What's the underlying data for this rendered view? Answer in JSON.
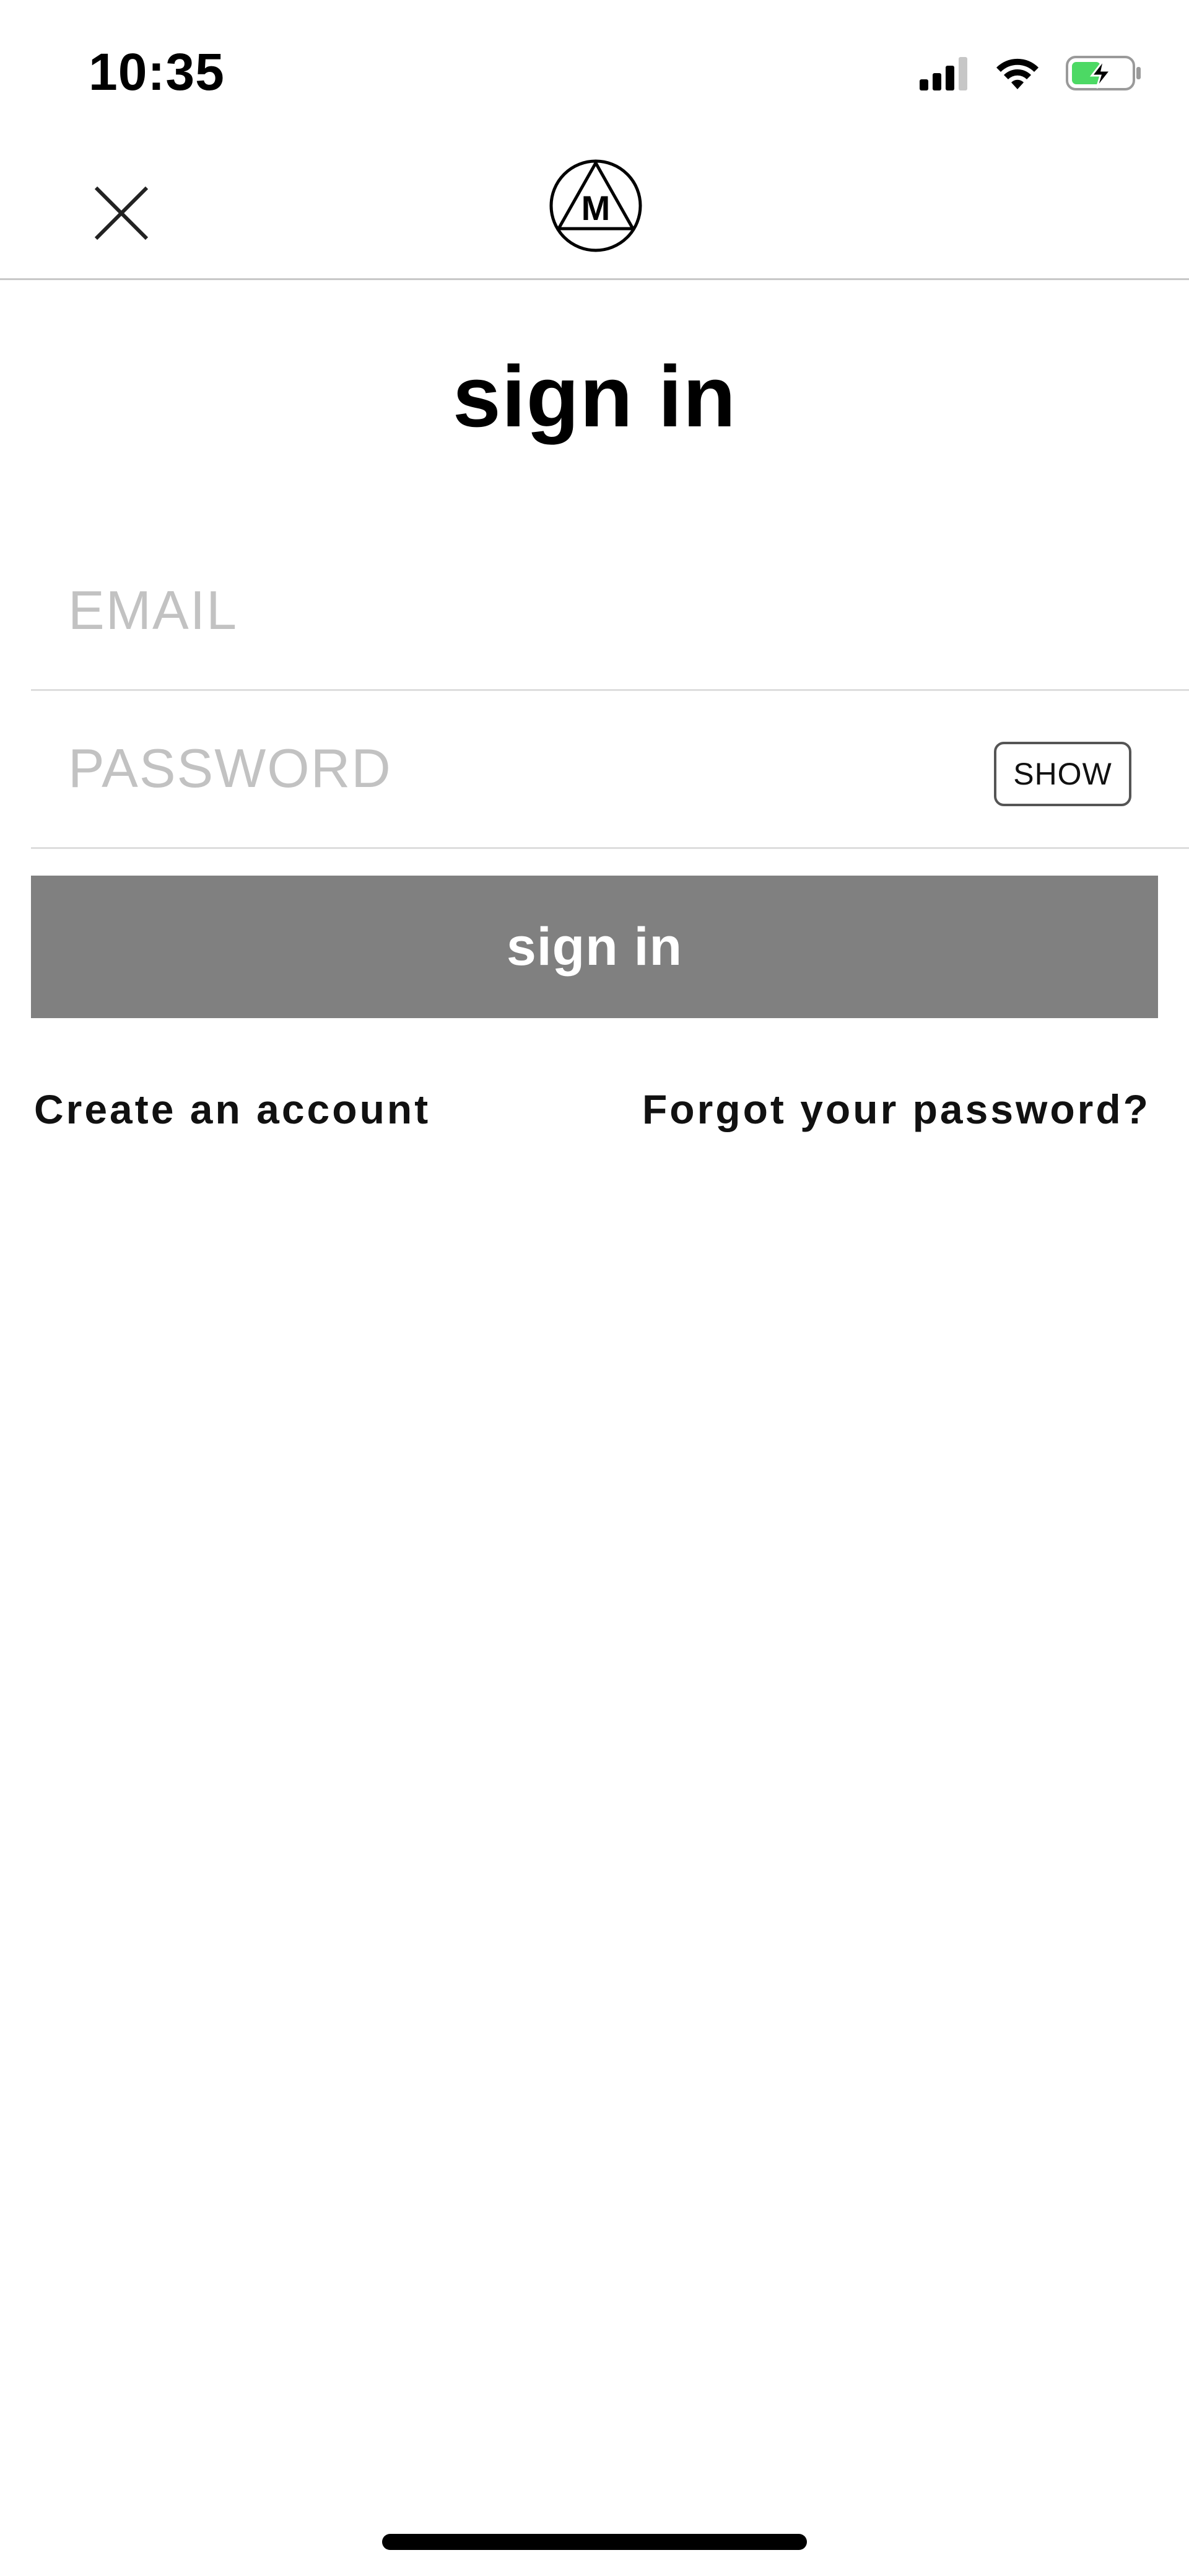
{
  "status_bar": {
    "time": "10:35",
    "icons": [
      "signal-icon",
      "wifi-icon",
      "battery-charging-icon"
    ],
    "battery_color": "#4cd964"
  },
  "nav": {
    "close_icon": "close-icon",
    "logo_letter": "M"
  },
  "page": {
    "title": "sign in"
  },
  "form": {
    "email_placeholder": "EMAIL",
    "password_placeholder": "PASSWORD",
    "show_label": "SHOW",
    "submit_label": "sign in"
  },
  "links": {
    "create_account": "Create an account",
    "forgot_password": "Forgot your password?"
  },
  "colors": {
    "button_bg": "#808080",
    "placeholder": "#c2c2c2",
    "divider": "#dddddd"
  }
}
